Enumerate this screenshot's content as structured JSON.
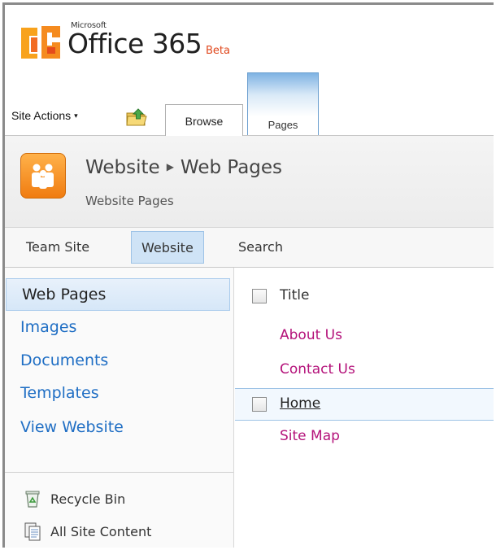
{
  "header": {
    "brand_small": "Microsoft",
    "brand_name": "Office 365",
    "brand_badge": "Beta",
    "site_actions_label": "Site Actions",
    "site_actions_caret": "▾",
    "tabs": [
      {
        "label": "Browse",
        "active": true
      },
      {
        "label": "Pages",
        "active": false
      }
    ]
  },
  "title_area": {
    "breadcrumb_root": "Website",
    "breadcrumb_separator": "▶",
    "breadcrumb_current": "Web Pages",
    "subtitle": "Website Pages",
    "icon": "people-site-icon",
    "icon_color": "#f58b1f"
  },
  "top_nav": {
    "items": [
      {
        "label": "Team Site",
        "selected": false
      },
      {
        "label": "Website",
        "selected": true
      },
      {
        "label": "Search",
        "selected": false
      }
    ]
  },
  "left_nav": {
    "items": [
      {
        "label": "Web Pages",
        "selected": true
      },
      {
        "label": "Images",
        "selected": false
      },
      {
        "label": "Documents",
        "selected": false
      },
      {
        "label": "Templates",
        "selected": false
      },
      {
        "label": "View Website",
        "selected": false
      }
    ],
    "utilities": [
      {
        "label": "Recycle Bin",
        "icon": "recycle-bin-icon"
      },
      {
        "label": "All Site Content",
        "icon": "all-site-content-icon"
      }
    ]
  },
  "list": {
    "column_title": "Title",
    "rows": [
      {
        "title": "About Us",
        "selected": false
      },
      {
        "title": "Contact Us",
        "selected": false
      },
      {
        "title": "Home",
        "selected": true
      },
      {
        "title": "Site Map",
        "selected": false
      }
    ]
  },
  "colors": {
    "link": "#1f6ec4",
    "list_link": "#b4127a",
    "selection": "#cfe3f6",
    "brand_badge": "#e0471c"
  }
}
